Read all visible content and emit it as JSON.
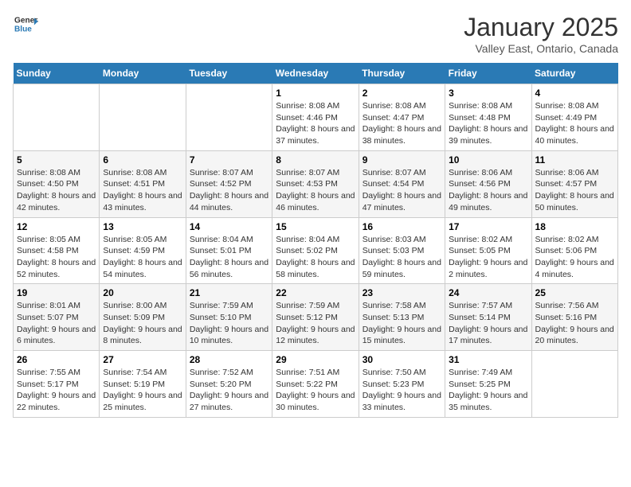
{
  "header": {
    "logo_line1": "General",
    "logo_line2": "Blue",
    "month": "January 2025",
    "location": "Valley East, Ontario, Canada"
  },
  "weekdays": [
    "Sunday",
    "Monday",
    "Tuesday",
    "Wednesday",
    "Thursday",
    "Friday",
    "Saturday"
  ],
  "weeks": [
    [
      {
        "day": "",
        "info": ""
      },
      {
        "day": "",
        "info": ""
      },
      {
        "day": "",
        "info": ""
      },
      {
        "day": "1",
        "info": "Sunrise: 8:08 AM\nSunset: 4:46 PM\nDaylight: 8 hours and 37 minutes."
      },
      {
        "day": "2",
        "info": "Sunrise: 8:08 AM\nSunset: 4:47 PM\nDaylight: 8 hours and 38 minutes."
      },
      {
        "day": "3",
        "info": "Sunrise: 8:08 AM\nSunset: 4:48 PM\nDaylight: 8 hours and 39 minutes."
      },
      {
        "day": "4",
        "info": "Sunrise: 8:08 AM\nSunset: 4:49 PM\nDaylight: 8 hours and 40 minutes."
      }
    ],
    [
      {
        "day": "5",
        "info": "Sunrise: 8:08 AM\nSunset: 4:50 PM\nDaylight: 8 hours and 42 minutes."
      },
      {
        "day": "6",
        "info": "Sunrise: 8:08 AM\nSunset: 4:51 PM\nDaylight: 8 hours and 43 minutes."
      },
      {
        "day": "7",
        "info": "Sunrise: 8:07 AM\nSunset: 4:52 PM\nDaylight: 8 hours and 44 minutes."
      },
      {
        "day": "8",
        "info": "Sunrise: 8:07 AM\nSunset: 4:53 PM\nDaylight: 8 hours and 46 minutes."
      },
      {
        "day": "9",
        "info": "Sunrise: 8:07 AM\nSunset: 4:54 PM\nDaylight: 8 hours and 47 minutes."
      },
      {
        "day": "10",
        "info": "Sunrise: 8:06 AM\nSunset: 4:56 PM\nDaylight: 8 hours and 49 minutes."
      },
      {
        "day": "11",
        "info": "Sunrise: 8:06 AM\nSunset: 4:57 PM\nDaylight: 8 hours and 50 minutes."
      }
    ],
    [
      {
        "day": "12",
        "info": "Sunrise: 8:05 AM\nSunset: 4:58 PM\nDaylight: 8 hours and 52 minutes."
      },
      {
        "day": "13",
        "info": "Sunrise: 8:05 AM\nSunset: 4:59 PM\nDaylight: 8 hours and 54 minutes."
      },
      {
        "day": "14",
        "info": "Sunrise: 8:04 AM\nSunset: 5:01 PM\nDaylight: 8 hours and 56 minutes."
      },
      {
        "day": "15",
        "info": "Sunrise: 8:04 AM\nSunset: 5:02 PM\nDaylight: 8 hours and 58 minutes."
      },
      {
        "day": "16",
        "info": "Sunrise: 8:03 AM\nSunset: 5:03 PM\nDaylight: 8 hours and 59 minutes."
      },
      {
        "day": "17",
        "info": "Sunrise: 8:02 AM\nSunset: 5:05 PM\nDaylight: 9 hours and 2 minutes."
      },
      {
        "day": "18",
        "info": "Sunrise: 8:02 AM\nSunset: 5:06 PM\nDaylight: 9 hours and 4 minutes."
      }
    ],
    [
      {
        "day": "19",
        "info": "Sunrise: 8:01 AM\nSunset: 5:07 PM\nDaylight: 9 hours and 6 minutes."
      },
      {
        "day": "20",
        "info": "Sunrise: 8:00 AM\nSunset: 5:09 PM\nDaylight: 9 hours and 8 minutes."
      },
      {
        "day": "21",
        "info": "Sunrise: 7:59 AM\nSunset: 5:10 PM\nDaylight: 9 hours and 10 minutes."
      },
      {
        "day": "22",
        "info": "Sunrise: 7:59 AM\nSunset: 5:12 PM\nDaylight: 9 hours and 12 minutes."
      },
      {
        "day": "23",
        "info": "Sunrise: 7:58 AM\nSunset: 5:13 PM\nDaylight: 9 hours and 15 minutes."
      },
      {
        "day": "24",
        "info": "Sunrise: 7:57 AM\nSunset: 5:14 PM\nDaylight: 9 hours and 17 minutes."
      },
      {
        "day": "25",
        "info": "Sunrise: 7:56 AM\nSunset: 5:16 PM\nDaylight: 9 hours and 20 minutes."
      }
    ],
    [
      {
        "day": "26",
        "info": "Sunrise: 7:55 AM\nSunset: 5:17 PM\nDaylight: 9 hours and 22 minutes."
      },
      {
        "day": "27",
        "info": "Sunrise: 7:54 AM\nSunset: 5:19 PM\nDaylight: 9 hours and 25 minutes."
      },
      {
        "day": "28",
        "info": "Sunrise: 7:52 AM\nSunset: 5:20 PM\nDaylight: 9 hours and 27 minutes."
      },
      {
        "day": "29",
        "info": "Sunrise: 7:51 AM\nSunset: 5:22 PM\nDaylight: 9 hours and 30 minutes."
      },
      {
        "day": "30",
        "info": "Sunrise: 7:50 AM\nSunset: 5:23 PM\nDaylight: 9 hours and 33 minutes."
      },
      {
        "day": "31",
        "info": "Sunrise: 7:49 AM\nSunset: 5:25 PM\nDaylight: 9 hours and 35 minutes."
      },
      {
        "day": "",
        "info": ""
      }
    ]
  ]
}
